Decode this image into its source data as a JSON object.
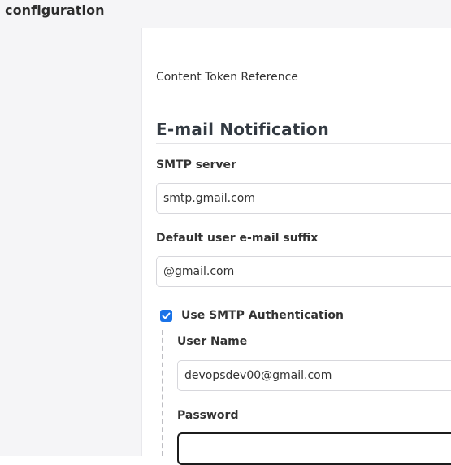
{
  "header": {
    "breadcrumb": "configuration"
  },
  "main": {
    "content_token_reference": "Content Token Reference",
    "section_title": "E-mail Notification",
    "smtp_server": {
      "label": "SMTP server",
      "value": "smtp.gmail.com"
    },
    "default_suffix": {
      "label": "Default user e-mail suffix",
      "value": "@gmail.com"
    },
    "use_smtp_auth": {
      "label": "Use SMTP Authentication",
      "checked": true
    },
    "user_name": {
      "label": "User Name",
      "value": "devopsdev00@gmail.com"
    },
    "password": {
      "label": "Password",
      "value": ""
    }
  },
  "colors": {
    "accent": "#1a73e8",
    "sidebar_bg": "#f5f5f7",
    "focus_border": "#1c1c1c"
  }
}
